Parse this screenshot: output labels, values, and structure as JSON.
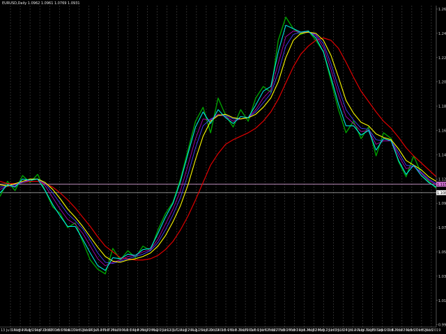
{
  "window": {
    "title": "EURUSD,Daily  1.0962 1.0961 1.0769 1.0931"
  },
  "colors": {
    "background": "#000000",
    "grid": "#4a4a4a",
    "price": "#00a000",
    "smooth": "#00e5e5",
    "ma_magenta": "#b000b0",
    "ma_blue": "#4040ff",
    "ma_yellow": "#ffff00",
    "ma_red": "#e00000",
    "level_line": "#c090c0",
    "level_tag": "#d070d0",
    "current_tag": "#ffffff"
  },
  "chart_data": {
    "type": "line",
    "symbol": "EURUSD",
    "timeframe": "Daily",
    "ohlc_header": "1.0962 1.0961 1.0769 1.0931",
    "x_ticks": [
      "13 Jul 2016",
      "3 Aug 2016",
      "24 Aug 2016",
      "15 Sep 2016",
      "7 Oct 2016",
      "28 Oct 2016",
      "18 Nov 2016",
      "12 Dec 2016",
      "3 Jan 2017",
      "24 Jan 2017",
      "14 Feb 2017",
      "7 Mar 2017",
      "28 Mar 2017",
      "18 Apr 2017",
      "9 May 2017",
      "30 May 2017",
      "20 Jun 2017",
      "11 Jul 2017",
      "1 Aug 2017",
      "22 Aug 2017",
      "12 Sep 2017",
      "3 Oct 2017",
      "24 Oct 2017",
      "14 Nov 2017",
      "5 Dec 2017",
      "26 Dec 2017",
      "16 Jan 2018",
      "6 Feb 2018",
      "27 Feb 2018",
      "20 Mar 2018",
      "10 Apr 2018",
      "1 May 2018",
      "22 May 2018",
      "12 Jun 2018",
      "3 Jul 2018",
      "24 Jul 2018",
      "14 Aug 2018",
      "4 Sep 2018",
      "25 Sep 2018",
      "16 Oct 2018",
      "6 Nov 2018",
      "27 Nov 2018",
      "18 Dec 2018",
      "8 Jan 2019"
    ],
    "y_ticks": [
      "1.2670",
      "1.2460",
      "1.2250",
      "1.2040",
      "1.1830",
      "1.1620",
      "1.1410",
      "1.1200",
      "1.0990",
      "1.0780",
      "1.0570",
      "1.0360",
      "1.0150",
      "0.9940"
    ],
    "y_range": [
      0.992,
      1.27
    ],
    "level_value": "1.1155",
    "current_value": "1.1082",
    "series": [
      {
        "key": "price",
        "values": [
          1.105,
          1.118,
          1.11,
          1.123,
          1.117,
          1.124,
          1.11,
          1.096,
          1.09,
          1.078,
          1.082,
          1.066,
          1.05,
          1.042,
          1.038,
          1.06,
          1.05,
          1.058,
          1.052,
          1.062,
          1.058,
          1.076,
          1.09,
          1.1,
          1.12,
          1.145,
          1.17,
          1.182,
          1.16,
          1.19,
          1.175,
          1.165,
          1.18,
          1.17,
          1.19,
          1.2,
          1.195,
          1.24,
          1.26,
          1.25,
          1.245,
          1.248,
          1.24,
          1.23,
          1.205,
          1.18,
          1.16,
          1.17,
          1.155,
          1.165,
          1.14,
          1.16,
          1.155,
          1.135,
          1.122,
          1.14,
          1.125,
          1.118,
          1.112
        ]
      },
      {
        "key": "smooth",
        "values": [
          1.108,
          1.115,
          1.113,
          1.12,
          1.119,
          1.12,
          1.11,
          1.098,
          1.088,
          1.079,
          1.079,
          1.068,
          1.056,
          1.045,
          1.041,
          1.052,
          1.051,
          1.055,
          1.054,
          1.059,
          1.06,
          1.073,
          1.087,
          1.099,
          1.118,
          1.142,
          1.165,
          1.178,
          1.168,
          1.18,
          1.173,
          1.168,
          1.174,
          1.173,
          1.184,
          1.196,
          1.2,
          1.23,
          1.253,
          1.25,
          1.247,
          1.248,
          1.242,
          1.23,
          1.208,
          1.185,
          1.166,
          1.166,
          1.158,
          1.162,
          1.145,
          1.155,
          1.153,
          1.136,
          1.124,
          1.132,
          1.123,
          1.117,
          1.113
        ]
      },
      {
        "key": "ma_magenta",
        "values": [
          1.111,
          1.114,
          1.114,
          1.118,
          1.119,
          1.12,
          1.114,
          1.104,
          1.094,
          1.085,
          1.081,
          1.073,
          1.062,
          1.051,
          1.045,
          1.048,
          1.05,
          1.053,
          1.054,
          1.057,
          1.059,
          1.068,
          1.081,
          1.094,
          1.11,
          1.132,
          1.155,
          1.172,
          1.171,
          1.176,
          1.174,
          1.17,
          1.172,
          1.173,
          1.18,
          1.19,
          1.197,
          1.22,
          1.243,
          1.248,
          1.247,
          1.247,
          1.244,
          1.234,
          1.215,
          1.193,
          1.174,
          1.168,
          1.161,
          1.162,
          1.15,
          1.153,
          1.153,
          1.14,
          1.129,
          1.131,
          1.125,
          1.119,
          1.115
        ]
      },
      {
        "key": "ma_blue",
        "values": [
          1.113,
          1.114,
          1.115,
          1.117,
          1.119,
          1.12,
          1.116,
          1.108,
          1.099,
          1.09,
          1.084,
          1.077,
          1.067,
          1.056,
          1.048,
          1.047,
          1.049,
          1.051,
          1.053,
          1.055,
          1.058,
          1.065,
          1.076,
          1.089,
          1.104,
          1.124,
          1.147,
          1.166,
          1.172,
          1.175,
          1.175,
          1.172,
          1.172,
          1.173,
          1.178,
          1.186,
          1.194,
          1.212,
          1.235,
          1.245,
          1.247,
          1.247,
          1.245,
          1.237,
          1.22,
          1.199,
          1.18,
          1.171,
          1.164,
          1.163,
          1.154,
          1.153,
          1.153,
          1.143,
          1.132,
          1.131,
          1.126,
          1.12,
          1.116
        ]
      },
      {
        "key": "ma_yellow",
        "values": [
          1.115,
          1.114,
          1.116,
          1.118,
          1.12,
          1.12,
          1.117,
          1.111,
          1.103,
          1.094,
          1.087,
          1.079,
          1.07,
          1.061,
          1.053,
          1.049,
          1.048,
          1.05,
          1.051,
          1.053,
          1.056,
          1.062,
          1.071,
          1.083,
          1.097,
          1.115,
          1.137,
          1.157,
          1.17,
          1.175,
          1.176,
          1.173,
          1.172,
          1.173,
          1.176,
          1.182,
          1.19,
          1.204,
          1.225,
          1.24,
          1.246,
          1.247,
          1.246,
          1.24,
          1.227,
          1.208,
          1.188,
          1.177,
          1.169,
          1.166,
          1.159,
          1.156,
          1.154,
          1.146,
          1.136,
          1.132,
          1.128,
          1.122,
          1.118
        ]
      },
      {
        "key": "ma_red",
        "values": [
          1.118,
          1.116,
          1.116,
          1.117,
          1.118,
          1.118,
          1.116,
          1.113,
          1.108,
          1.102,
          1.095,
          1.087,
          1.079,
          1.07,
          1.062,
          1.057,
          1.052,
          1.051,
          1.05,
          1.05,
          1.051,
          1.054,
          1.059,
          1.066,
          1.076,
          1.088,
          1.102,
          1.117,
          1.132,
          1.142,
          1.15,
          1.154,
          1.157,
          1.16,
          1.164,
          1.17,
          1.178,
          1.189,
          1.203,
          1.217,
          1.228,
          1.235,
          1.24,
          1.242,
          1.24,
          1.233,
          1.221,
          1.208,
          1.196,
          1.187,
          1.178,
          1.17,
          1.164,
          1.156,
          1.147,
          1.14,
          1.134,
          1.128,
          1.122
        ]
      }
    ]
  }
}
